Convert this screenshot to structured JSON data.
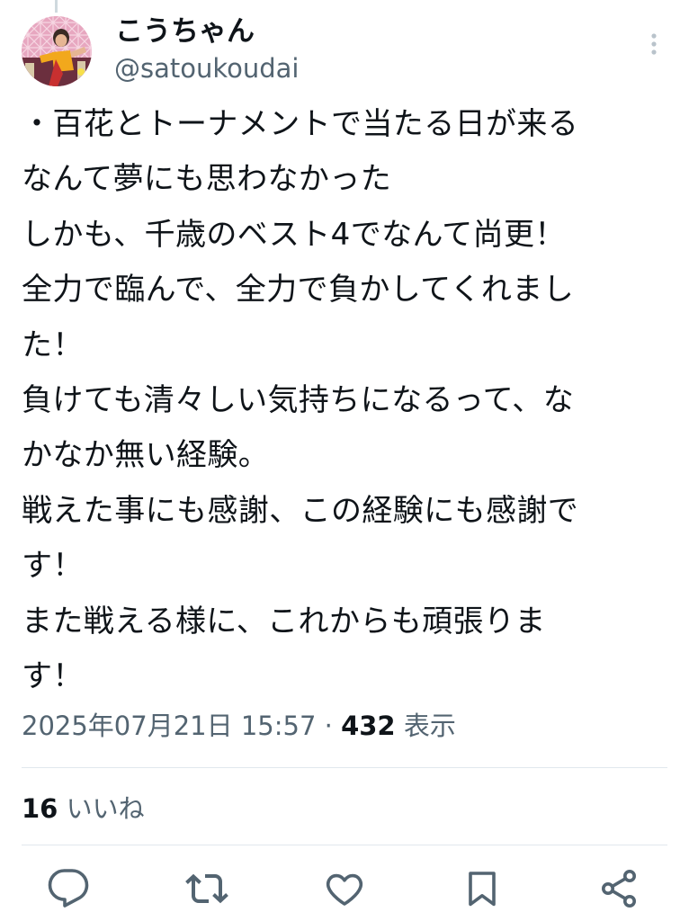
{
  "author": {
    "display_name": "こうちゃん",
    "handle": "@satoukoudai"
  },
  "tweet": {
    "lines": [
      "・百花とトーナメントで当たる日が来る",
      "なんて夢にも思わなかった",
      "しかも、千歳のベスト4でなんて尚更！",
      "全力で臨んで、全力で負かしてくれまし",
      "た！",
      "負けても清々しい気持ちになるって、な",
      "かなか無い経験。",
      "戦えた事にも感謝、この経験にも感謝で",
      "す！",
      "また戦える様に、これからも頑張りま",
      "す！"
    ]
  },
  "meta": {
    "timestamp": "2025年07月21日 15:57",
    "separator": "·",
    "views_count": "432",
    "views_label": "表示"
  },
  "engagement": {
    "likes_count": "16",
    "likes_label": "いいね"
  },
  "icons": {
    "more": "more-vertical-icon",
    "reply": "reply-icon",
    "retweet": "retweet-icon",
    "like": "heart-icon",
    "bookmark": "bookmark-icon",
    "share": "share-icon"
  },
  "colors": {
    "text_primary": "#0f1419",
    "text_secondary": "#536471",
    "divider": "#e1e8ed"
  }
}
